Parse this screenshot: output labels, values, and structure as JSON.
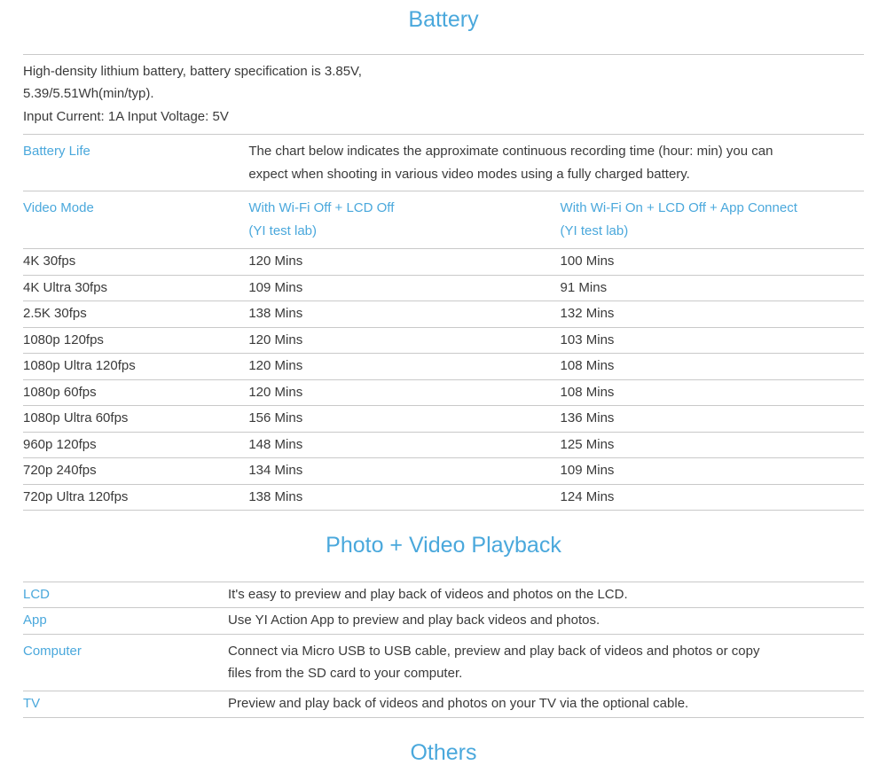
{
  "sections": {
    "battery": {
      "heading": "Battery",
      "intro": {
        "lines": [
          "High-density lithium battery, battery specification is 3.85V,",
          "5.39/5.51Wh(min/typ).",
          "Input Current: 1A Input Voltage: 5V"
        ]
      },
      "battery_life": {
        "label": "Battery Life",
        "description_lines": [
          "The chart below indicates the approximate continuous recording time (hour: min) you can",
          "expect when shooting in various video modes using a fully charged battery."
        ]
      },
      "table": {
        "headers": {
          "mode": "Video Mode",
          "wifi_off_line1": "With Wi-Fi Off + LCD Off",
          "wifi_off_line2": "(YI test lab)",
          "wifi_on_line1": "With Wi-Fi On + LCD Off + App Connect",
          "wifi_on_line2": "(YI test lab)"
        },
        "rows": [
          {
            "mode": "4K 30fps",
            "wifi_off": "120 Mins",
            "wifi_on": "100 Mins"
          },
          {
            "mode": "4K Ultra 30fps",
            "wifi_off": "109 Mins",
            "wifi_on": "91 Mins"
          },
          {
            "mode": "2.5K 30fps",
            "wifi_off": "138 Mins",
            "wifi_on": "132 Mins"
          },
          {
            "mode": "1080p 120fps",
            "wifi_off": "120 Mins",
            "wifi_on": "103 Mins"
          },
          {
            "mode": "1080p Ultra 120fps",
            "wifi_off": "120 Mins",
            "wifi_on": "108 Mins"
          },
          {
            "mode": "1080p 60fps",
            "wifi_off": "120 Mins",
            "wifi_on": "108 Mins"
          },
          {
            "mode": "1080p Ultra 60fps",
            "wifi_off": "156 Mins",
            "wifi_on": "136 Mins"
          },
          {
            "mode": "960p 120fps",
            "wifi_off": "148 Mins",
            "wifi_on": "125 Mins"
          },
          {
            "mode": "720p 240fps",
            "wifi_off": "134 Mins",
            "wifi_on": "109 Mins"
          },
          {
            "mode": "720p Ultra 120fps",
            "wifi_off": "138 Mins",
            "wifi_on": "124 Mins"
          }
        ]
      }
    },
    "playback": {
      "heading": "Photo + Video Playback",
      "rows": [
        {
          "label": "LCD",
          "description_lines": [
            "It's easy to preview and play back of videos and photos on the LCD."
          ]
        },
        {
          "label": "App",
          "description_lines": [
            "Use YI Action App to preview and play back videos and photos."
          ]
        },
        {
          "label": "Computer",
          "description_lines": [
            "Connect via Micro USB to USB cable, preview and play back of videos and photos or copy",
            "files from the SD card to your computer."
          ]
        },
        {
          "label": "TV",
          "description_lines": [
            "Preview and play back of videos and photos on your TV via the optional cable."
          ]
        }
      ]
    },
    "others": {
      "heading": "Others"
    }
  },
  "colors": {
    "accent": "#4aa8dc",
    "body_text": "#3a3a3a",
    "rule": "#c9c9c9",
    "background": "#ffffff"
  }
}
